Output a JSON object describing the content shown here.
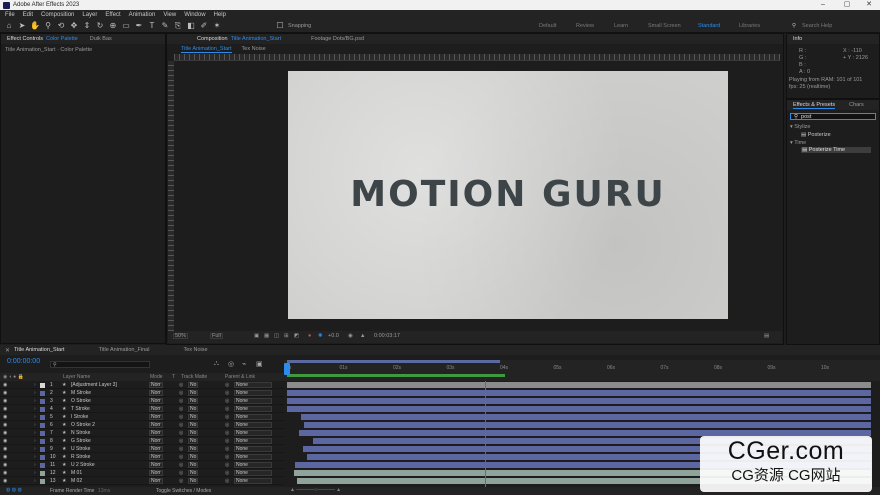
{
  "titlebar": {
    "title": "Adobe After Effects 2023",
    "minimize": "–",
    "maximize": "▢",
    "close": "✕"
  },
  "menu": [
    "File",
    "Edit",
    "Composition",
    "Layer",
    "Effect",
    "Animation",
    "View",
    "Window",
    "Help"
  ],
  "toolbar": {
    "snapping_label": "Snapping",
    "workspaces": [
      "Default",
      "Review",
      "Learn",
      "Small Screen",
      "Standard",
      "Libraries"
    ],
    "active_workspace": "Standard",
    "search_placeholder": "Search Help"
  },
  "effect_controls": {
    "tab_prefix": "Effect Controls",
    "tab_name": "Color Palette",
    "tab2": "Duik Bas",
    "path": "Title Animation_Start · Color Palette"
  },
  "composition": {
    "tab_prefix": "Composition",
    "tab_name": "Title Animation_Start",
    "footage_tab": "Footage  Dots/BG.psd",
    "subtabs": [
      "Title Animation_Start",
      "Tex Noise"
    ],
    "canvas_text": "MOTION GURU",
    "zoom": "50%",
    "resolution": "Full",
    "exposure": "+0.0",
    "timecode": "0:00:03:17"
  },
  "info": {
    "title": "Info",
    "channels": [
      "R :",
      "G :",
      "B :",
      "A : 0"
    ],
    "x": "X : -110",
    "y": "+ Y : 2126",
    "playing": "Playing from RAM: 101 of 101",
    "fps": "fps: 25 (realtime)"
  },
  "effects_presets": {
    "tab": "Effects & Presets",
    "tab2": "Chars",
    "search": "post",
    "groups": [
      {
        "name": "Stylize",
        "items": [
          "Posterize"
        ]
      },
      {
        "name": "Time",
        "items": [
          "Posterize Time"
        ]
      }
    ]
  },
  "timeline": {
    "tabs": [
      "Title Animation_Start",
      "Title Animation_Final",
      "Tex Noise"
    ],
    "timecode": "0:00:00:00",
    "columns": [
      "Layer Name",
      "Mode",
      "T",
      "Track Matte",
      "Parent & Link"
    ],
    "ruler_ticks": [
      "0s",
      "01s",
      "02s",
      "03s",
      "04s",
      "05s",
      "06s",
      "07s",
      "08s",
      "09s",
      "10s"
    ],
    "mode_value": "Norr",
    "matte_value": "No",
    "parent_value": "None",
    "layers": [
      {
        "num": "1",
        "name": "[Adjustment Layer 3]",
        "color": "#d8d8d8",
        "bar_start_pct": 0,
        "bar_color": "gray"
      },
      {
        "num": "2",
        "name": "M Stroke",
        "color": "#5c66a0",
        "bar_start_pct": 0,
        "bar_color": "blue"
      },
      {
        "num": "3",
        "name": "O Stroke",
        "color": "#5c66a0",
        "bar_start_pct": 0,
        "bar_color": "blue"
      },
      {
        "num": "4",
        "name": "T Stroke",
        "color": "#5c66a0",
        "bar_start_pct": 0,
        "bar_color": "blue"
      },
      {
        "num": "5",
        "name": "I Stroke",
        "color": "#5c66a0",
        "bar_start_pct": 2.4,
        "bar_color": "blue"
      },
      {
        "num": "6",
        "name": "O Stroke 2",
        "color": "#5c66a0",
        "bar_start_pct": 2.9,
        "bar_color": "blue"
      },
      {
        "num": "7",
        "name": "N Stroke",
        "color": "#5c66a0",
        "bar_start_pct": 2.0,
        "bar_color": "blue"
      },
      {
        "num": "8",
        "name": "G Stroke",
        "color": "#5c66a0",
        "bar_start_pct": 4.5,
        "bar_color": "blue"
      },
      {
        "num": "9",
        "name": "U Stroke",
        "color": "#5c66a0",
        "bar_start_pct": 2.7,
        "bar_color": "blue"
      },
      {
        "num": "10",
        "name": "R Stroke",
        "color": "#5c66a0",
        "bar_start_pct": 3.4,
        "bar_color": "blue"
      },
      {
        "num": "11",
        "name": "U 2 Stroke",
        "color": "#5c66a0",
        "bar_start_pct": 1.4,
        "bar_color": "blue"
      },
      {
        "num": "12",
        "name": "M 01",
        "color": "#8fa39a",
        "bar_start_pct": 1.2,
        "bar_color": "teal"
      },
      {
        "num": "13",
        "name": "M 02",
        "color": "#8fa39a",
        "bar_start_pct": 1.7,
        "bar_color": "teal"
      }
    ],
    "status_left": "Frame Render Time",
    "status_ms": "13ms",
    "status_mid": "Toggle Switches / Modes"
  },
  "watermark": {
    "title": "CGer.com",
    "subtitle": "CG资源 CG网站"
  }
}
